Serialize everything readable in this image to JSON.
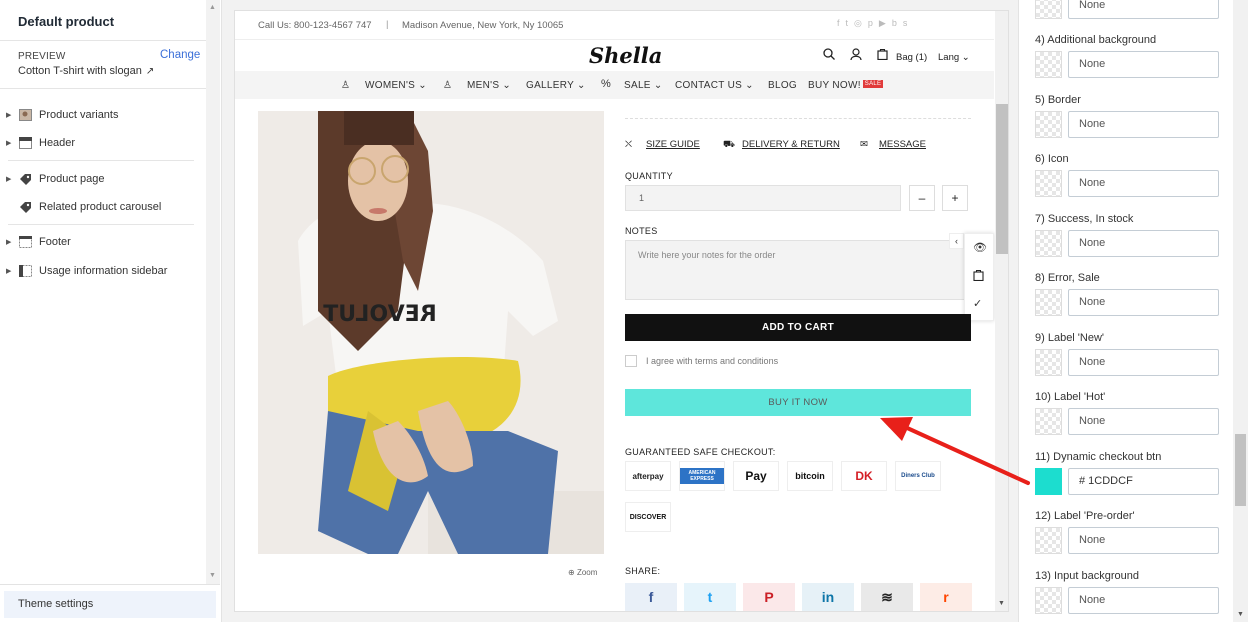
{
  "left": {
    "title": "Default product",
    "preview_label": "PREVIEW",
    "change": "Change",
    "preview_name": "Cotton T-shirt with slogan",
    "sections": [
      {
        "label": "Product variants",
        "icon": "image-icon"
      },
      {
        "label": "Header",
        "icon": "header-layout-icon"
      },
      {
        "label": "Product page",
        "icon": "tag-icon"
      },
      {
        "label": "Related product carousel",
        "icon": "tag-icon"
      },
      {
        "label": "Footer",
        "icon": "footer-layout-icon"
      },
      {
        "label": "Usage information sidebar",
        "icon": "sidebar-layout-icon"
      }
    ],
    "theme_settings": "Theme settings"
  },
  "store": {
    "call": "Call Us: 800-123-4567 747",
    "separator": "|",
    "address": "Madison Avenue, New York, Ny 10065",
    "social": [
      "f",
      "t",
      "◎",
      "p",
      "▶",
      "b",
      "s"
    ],
    "logo": "Shella",
    "bag": "Bag (1)",
    "lang": "Lang ⌄",
    "nav": [
      "WOMEN'S ⌄",
      "MEN'S ⌄",
      "GALLERY ⌄",
      "SALE ⌄",
      "CONTACT US ⌄",
      "BLOG",
      "BUY NOW!"
    ],
    "sale_badge": "SALE",
    "zoom": "Zoom",
    "links": [
      "SIZE GUIDE",
      "DELIVERY & RETURN",
      "MESSAGE"
    ],
    "quantity_label": "QUANTITY",
    "quantity_value": "1",
    "minus": "–",
    "plus": "+",
    "notes_label": "NOTES",
    "notes_placeholder": "Write here your notes for the order",
    "add_to_cart": "ADD TO CART",
    "agree": "I agree with terms and conditions",
    "buy_now": "BUY IT NOW",
    "buy_now_color": "#5EE6DB",
    "guaranteed": "GUARANTEED SAFE CHECKOUT:",
    "payments": [
      "afterpay",
      "AMERICAN EXPRESS",
      "Pay",
      "bitcoin",
      "DK",
      "Diners Club",
      "DISCOVER"
    ],
    "share": "SHARE:",
    "share_buttons": [
      "f",
      "t",
      "P",
      "in",
      "≋",
      "r"
    ],
    "shirt_text": "REVOLUT"
  },
  "right": {
    "top_value": "None",
    "settings": [
      {
        "label": "4) Additional background",
        "value": "None"
      },
      {
        "label": "5) Border",
        "value": "None"
      },
      {
        "label": "6) Icon",
        "value": "None"
      },
      {
        "label": "7) Success, In stock",
        "value": "None"
      },
      {
        "label": "8) Error, Sale",
        "value": "None"
      },
      {
        "label": "9) Label 'New'",
        "value": "None"
      },
      {
        "label": "10) Label 'Hot'",
        "value": "None"
      },
      {
        "label": "11) Dynamic checkout btn",
        "value": "#  1CDDCF",
        "color": "#1CDDCF"
      },
      {
        "label": "12) Label 'Pre-order'",
        "value": "None"
      },
      {
        "label": "13) Input background",
        "value": "None"
      }
    ]
  },
  "colors": {
    "arrow": "#E8201A",
    "accent": "#3B6FD8"
  }
}
